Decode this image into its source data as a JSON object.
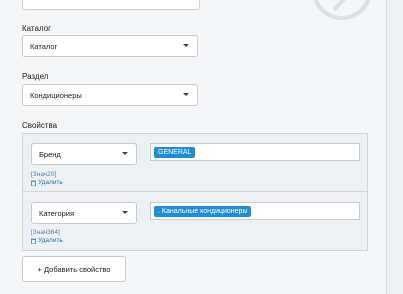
{
  "fields": {
    "catalog_label": "Каталог",
    "catalog_value": "Каталог",
    "section_label": "Раздел",
    "section_value": "Кондиционеры",
    "properties_label": "Свойства"
  },
  "properties": [
    {
      "name": "Бренд",
      "tag": "GENERAL",
      "meta": "[Знач20]",
      "delete": "Удалить"
    },
    {
      "name": "Категория",
      "tag": ". Канальные кондиционеры",
      "meta": "[Знач364]",
      "delete": "Удалить"
    }
  ],
  "add_button": "+ Добавить свойство",
  "colors": {
    "accent": "#1e8fd7",
    "link": "#2a6fb4"
  }
}
